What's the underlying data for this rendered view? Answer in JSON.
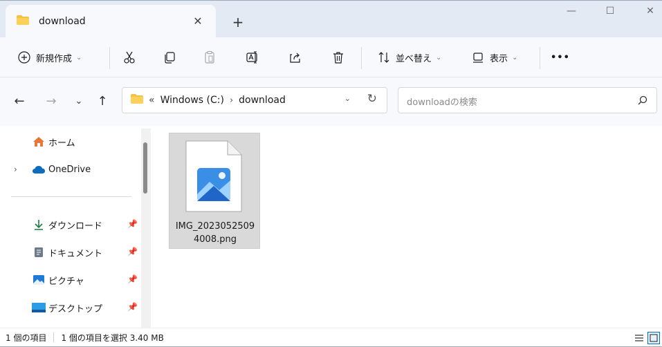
{
  "window": {
    "tab_title": "download",
    "tab_close": "✕",
    "new_tab": "+",
    "minimize": "—",
    "maximize": "☐",
    "close": "✕"
  },
  "toolbar": {
    "new_label": "新規作成",
    "sort_label": "並べ替え",
    "view_label": "表示",
    "more": "•••"
  },
  "address": {
    "overflow": "«",
    "drive": "Windows (C:)",
    "separator": "›",
    "folder": "download",
    "search_placeholder": "downloadの検索"
  },
  "sidebar": {
    "home": "ホーム",
    "onedrive": "OneDrive",
    "downloads": "ダウンロード",
    "documents": "ドキュメント",
    "pictures": "ピクチャ",
    "desktop": "デスクトップ"
  },
  "files": [
    {
      "name": "IMG_20230525094008.png",
      "name_line1": "IMG_2023052509",
      "name_line2": "4008.png",
      "selected": true
    }
  ],
  "status": {
    "item_count": "1 個の項目",
    "selection": "1 個の項目を選択  3.40 MB"
  },
  "colors": {
    "accent": "#0067c0",
    "folder": "#f7c244",
    "titlebar_bg": "#e3eaf3",
    "selection_bg": "#d9d9d9"
  }
}
